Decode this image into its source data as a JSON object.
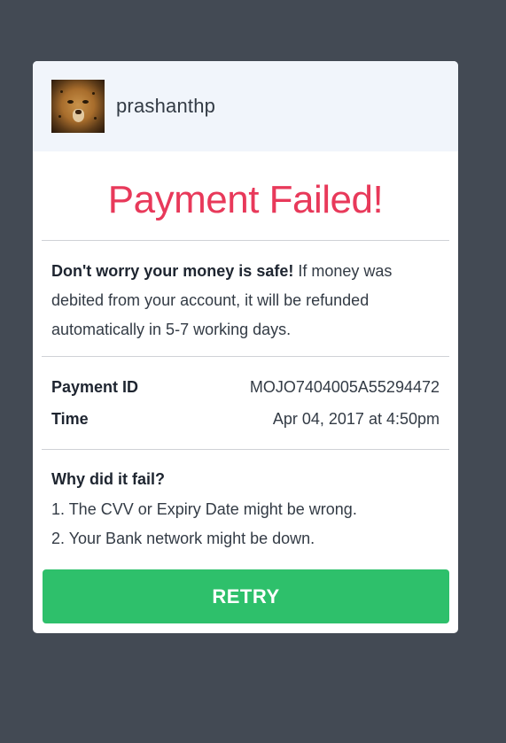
{
  "user": {
    "name": "prashanthp",
    "avatar_icon": "cheetah-avatar"
  },
  "title": "Payment Failed!",
  "message": {
    "bold": "Don't worry your money is safe!",
    "text": " If money was debited from your account, it will be refunded automatically in 5-7 working days."
  },
  "details": [
    {
      "label": "Payment ID",
      "value": "MOJO7404005A55294472"
    },
    {
      "label": "Time",
      "value": "Apr 04, 2017 at 4:50pm"
    }
  ],
  "reasons": {
    "heading": "Why did it fail?",
    "items": [
      "1. The CVV or Expiry Date might be wrong.",
      "2. Your Bank network might be down."
    ]
  },
  "retry_label": "RETRY",
  "colors": {
    "background": "#434a54",
    "error": "#e8395a",
    "success": "#2ec06b",
    "header": "#f1f5fb"
  }
}
